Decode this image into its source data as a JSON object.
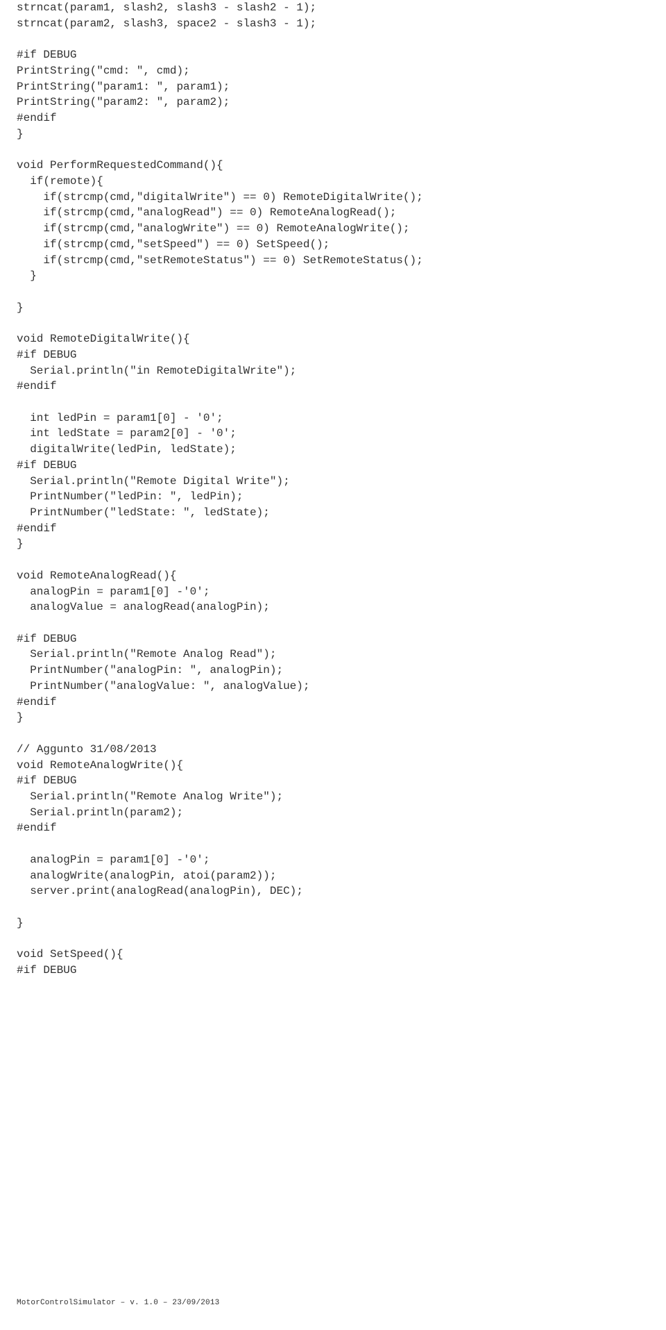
{
  "code_lines": [
    "strncat(param1, slash2, slash3 - slash2 - 1);",
    "strncat(param2, slash3, space2 - slash3 - 1);",
    "",
    "#if DEBUG",
    "PrintString(\"cmd: \", cmd);",
    "PrintString(\"param1: \", param1);",
    "PrintString(\"param2: \", param2);",
    "#endif",
    "}",
    "",
    "void PerformRequestedCommand(){",
    "  if(remote){",
    "    if(strcmp(cmd,\"digitalWrite\") == 0) RemoteDigitalWrite();",
    "    if(strcmp(cmd,\"analogRead\") == 0) RemoteAnalogRead();",
    "    if(strcmp(cmd,\"analogWrite\") == 0) RemoteAnalogWrite();",
    "    if(strcmp(cmd,\"setSpeed\") == 0) SetSpeed();",
    "    if(strcmp(cmd,\"setRemoteStatus\") == 0) SetRemoteStatus();",
    "  }",
    "",
    "}",
    "",
    "void RemoteDigitalWrite(){",
    "#if DEBUG",
    "  Serial.println(\"in RemoteDigitalWrite\");",
    "#endif",
    "",
    "  int ledPin = param1[0] - '0';",
    "  int ledState = param2[0] - '0';",
    "  digitalWrite(ledPin, ledState);",
    "#if DEBUG",
    "  Serial.println(\"Remote Digital Write\");",
    "  PrintNumber(\"ledPin: \", ledPin);",
    "  PrintNumber(\"ledState: \", ledState);",
    "#endif",
    "}",
    "",
    "void RemoteAnalogRead(){",
    "  analogPin = param1[0] -'0';",
    "  analogValue = analogRead(analogPin);",
    "",
    "#if DEBUG",
    "  Serial.println(\"Remote Analog Read\");",
    "  PrintNumber(\"analogPin: \", analogPin);",
    "  PrintNumber(\"analogValue: \", analogValue);",
    "#endif",
    "}",
    "",
    "// Aggunto 31/08/2013",
    "void RemoteAnalogWrite(){",
    "#if DEBUG",
    "  Serial.println(\"Remote Analog Write\");",
    "  Serial.println(param2);",
    "#endif",
    "",
    "  analogPin = param1[0] -'0';",
    "  analogWrite(analogPin, atoi(param2));",
    "  server.print(analogRead(analogPin), DEC);",
    "",
    "}",
    "",
    "void SetSpeed(){",
    "#if DEBUG"
  ],
  "footer": "MotorControlSimulator – v.  1.0 – 23/09/2013"
}
